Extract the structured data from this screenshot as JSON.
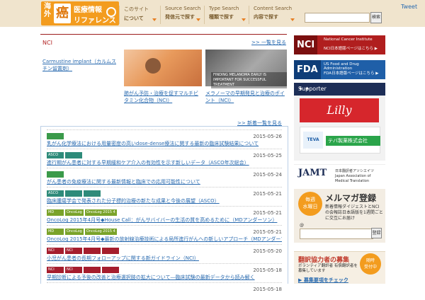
{
  "header": {
    "logo": {
      "kaigai": "海外",
      "kan": "癌",
      "title1": "医療情報",
      "title2": "リファレンス"
    },
    "nav": [
      {
        "en": "このサイト",
        "jp": "について"
      },
      {
        "en": "Source Search",
        "jp": "発信元で探す"
      },
      {
        "en": "Type Search",
        "jp": "種類で探す"
      },
      {
        "en": "Content Search",
        "jp": "内容で探す"
      }
    ],
    "tweet": "Tweet",
    "search": {
      "placeholder": "",
      "button": "検索"
    }
  },
  "main": {
    "section_label": "NCI",
    "more_link": ">> 一覧を見る",
    "article_left": "Carmustine implant（カルムスチン留置剤）",
    "photo2_caption": "FINDING MELANOMA EARLY IS IMPORTANT FOR SUCCESSFUL TREATMENT",
    "photo_captions": [
      "肺がん予防・治療を促すマルチビタミン化合物（NCI）",
      "メラノーマの早期発見と治療のポイント（NCI）"
    ],
    "news_more": ">> 新着一覧を見る",
    "news": [
      {
        "date": "2015-05-26",
        "tags": [
          {
            "label": "",
            "color": "#3a9a4a"
          }
        ],
        "title": "乳がん化学療法における用量密度の高いdose-dense療法に関する最新の臨床試験結果について"
      },
      {
        "date": "2015-05-25",
        "tags": [
          {
            "label": "ASCO",
            "color": "#2e8b7a"
          },
          {
            "label": "",
            "color": "#2e8b7a"
          }
        ],
        "title": "進行期がん患者に対する早期緩和ケア介入の有効性を示す新しいデータ（ASCO年次総会）"
      },
      {
        "date": "2015-05-24",
        "tags": [
          {
            "label": "",
            "color": "#3a9a4a"
          }
        ],
        "title": "がん患者の免疫療法に関する最新情報と臨床での応用可能性について"
      },
      {
        "date": "2015-05-21",
        "tags": [
          {
            "label": "ASCO",
            "color": "#2e8b7a"
          },
          {
            "label": "",
            "color": "#2e8b7a"
          },
          {
            "label": "",
            "color": "#2e8b7a"
          }
        ],
        "title": "臨床腫瘍学会で発表された分子標的治療の新たな成果と今後の展望（ASCO）"
      },
      {
        "date": "2015-05-21",
        "tags": [
          {
            "label": "MD",
            "color": "#7aa32a"
          },
          {
            "label": "OncoLog",
            "color": "#7aa32a"
          },
          {
            "label": "OncoLog 2015 4",
            "color": "#7aa32a"
          }
        ],
        "title": "OncoLog 2015年4月号◆House Call：がんサバイバーの生活の質を高めるために（MDアンダーソン）"
      },
      {
        "date": "2015-05-21",
        "tags": [
          {
            "label": "MD",
            "color": "#7aa32a"
          },
          {
            "label": "OncoLog",
            "color": "#7aa32a"
          },
          {
            "label": "OncoLog 2015 4",
            "color": "#7aa32a"
          }
        ],
        "title": "OncoLog 2015年4月号◆最新の放射線治療技術による局所進行がんへの新しいアプローチ（MDアンダーソンがんセンター）"
      },
      {
        "date": "2015-05-20",
        "tags": [
          {
            "label": "NCI",
            "color": "#a51d2d"
          },
          {
            "label": "NCI",
            "color": "#a51d2d"
          },
          {
            "label": "",
            "color": "#a51d2d"
          },
          {
            "label": "",
            "color": "#a51d2d"
          }
        ],
        "title": "小児がん患者の長期フォローアップに関する新ガイドライン（NCI）"
      },
      {
        "date": "2015-05-18",
        "tags": [
          {
            "label": "NCI",
            "color": "#a51d2d"
          },
          {
            "label": "NCI",
            "color": "#a51d2d"
          },
          {
            "label": "",
            "color": "#a51d2d"
          },
          {
            "label": "",
            "color": "#a51d2d"
          }
        ],
        "title": "早期診断による予後の改善と治療選択肢の拡大について―臨床試験の最新データから読み解く"
      },
      {
        "date": "2015-05-18",
        "tags": [],
        "title": ""
      }
    ]
  },
  "sidebar": {
    "nci": {
      "big": "NCI",
      "s1": "National Cancer Institute",
      "s2": "NCI日本語版ページはこちら ▶"
    },
    "fda": {
      "big": "FDA",
      "s1": "US Food and Drug Administration",
      "s2": "FDA日本語版ページはこちら ▶"
    },
    "supporter": {
      "title": "Supporter",
      "stars": "✦ ✦",
      "lilly": "Lilly",
      "teva_logo": "TEVA",
      "teva_name": "テバ製薬株式会社"
    },
    "jamt": {
      "logo": "JAMT",
      "sub": "日本翻訳者アソシエイツ Japan Association of Medical Translation"
    },
    "mailmag": {
      "badge1": "毎週",
      "badge2": "水曜日",
      "title": "メルマガ登録",
      "text": "新着情報ダイジェストとNCIの会報誌日本語版を1週間ごとに交互にお届け",
      "at": "@",
      "button": "登録"
    },
    "recruit": {
      "title": "翻訳協力者の募集",
      "sub": "ボランティア翻訳者 有償翻訳者を募集しています",
      "link": "▶ 募集要項をチェック",
      "circle1": "随時",
      "circle2": "受付中"
    }
  },
  "colors": {
    "header_bg": "#f0e4cd",
    "logo_orange": "#f39c1e",
    "nci_red": "#b01e1e",
    "fda_blue": "#1f5fa8",
    "link": "#2a6bb0"
  }
}
